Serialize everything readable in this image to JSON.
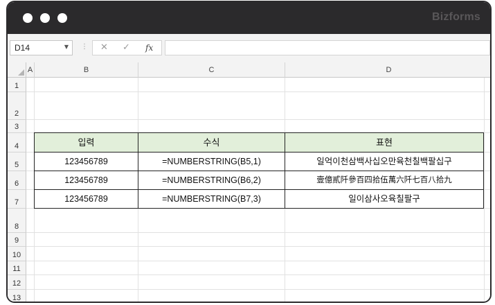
{
  "window": {
    "brand": "Bizforms"
  },
  "formula_bar": {
    "name_box": "D14",
    "cancel_icon": "✕",
    "enter_icon": "✓",
    "fx_icon": "fx",
    "formula": ""
  },
  "columns": [
    "A",
    "B",
    "C",
    "D"
  ],
  "rows": [
    "1",
    "2",
    "3",
    "4",
    "5",
    "6",
    "7",
    "8",
    "9",
    "10",
    "11",
    "12",
    "13"
  ],
  "table": {
    "headers": [
      "입력",
      "수식",
      "표현"
    ],
    "rows": [
      [
        "123456789",
        "=NUMBERSTRING(B5,1)",
        "일억이천삼백사십오만육천칠백팔십구"
      ],
      [
        "123456789",
        "=NUMBERSTRING(B6,2)",
        "壹億貳阡參百四拾伍萬六阡七百八拾九"
      ],
      [
        "123456789",
        "=NUMBERSTRING(B7,3)",
        "일이삼사오육칠팔구"
      ]
    ]
  },
  "colors": {
    "titlebar": "#2b2a2c",
    "header_fill": "#e2efda"
  }
}
